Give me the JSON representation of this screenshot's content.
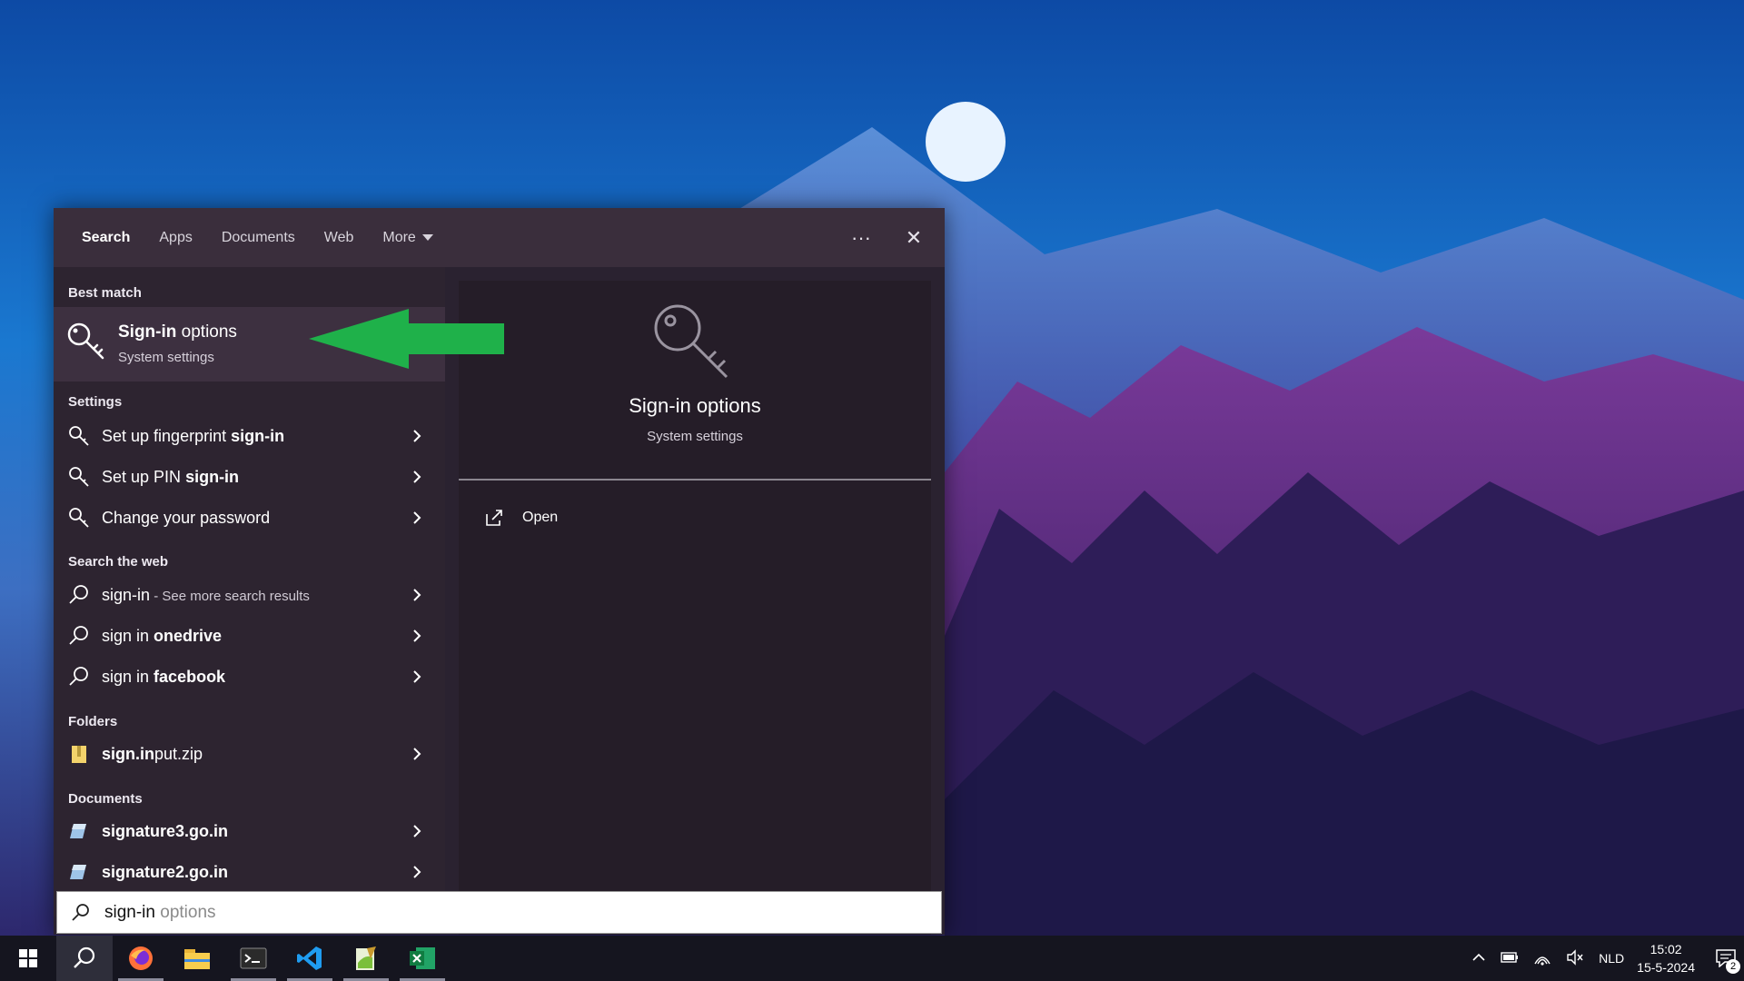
{
  "tabs": {
    "items": [
      "Search",
      "Apps",
      "Documents",
      "Web",
      "More"
    ],
    "more_icon": "caret-down-icon",
    "tools": [
      "ellipsis-icon",
      "close-icon"
    ],
    "ellipsis": "···",
    "close": "✕"
  },
  "left": {
    "best_match_heading": "Best match",
    "best_match": {
      "title_bold": "Sign-in",
      "title_rest": " options",
      "subtitle": "System settings",
      "icon": "key-icon"
    },
    "settings_heading": "Settings",
    "settings": [
      {
        "pre": "Set up fingerprint ",
        "bold": "sign-in"
      },
      {
        "pre": "Set up PIN ",
        "bold": "sign-in"
      },
      {
        "pre": "Change your password",
        "bold": ""
      }
    ],
    "web_heading": "Search the web",
    "web": [
      {
        "pre": "sign-in",
        "bold": "",
        "sub": " - See more search results"
      },
      {
        "pre": "sign in ",
        "bold": "onedrive",
        "sub": ""
      },
      {
        "pre": "sign in ",
        "bold": "facebook",
        "sub": ""
      }
    ],
    "folders_heading": "Folders",
    "folders": [
      {
        "bold1": "sign.in",
        "rest": "put.zip"
      }
    ],
    "documents_heading": "Documents",
    "documents": [
      {
        "bold": "signature3.go.in"
      },
      {
        "bold": "signature2.go.in"
      }
    ]
  },
  "preview": {
    "title": "Sign-in options",
    "subtitle": "System settings",
    "open_label": "Open",
    "icon": "key-icon"
  },
  "search": {
    "typed": "sign-in",
    "suggestion": " options"
  },
  "taskbar": {
    "apps": [
      "windows-start-icon",
      "search-icon",
      "firefox-icon",
      "file-explorer-icon",
      "terminal-icon",
      "vscode-icon",
      "notepadpp-icon",
      "excel-icon"
    ],
    "language": "NLD",
    "time": "15:02",
    "date": "15-5-2024",
    "notifications": "2"
  },
  "colors": {
    "panel": "#2a2230",
    "arrow": "#1fb14a",
    "taskbar": "#15151f"
  }
}
